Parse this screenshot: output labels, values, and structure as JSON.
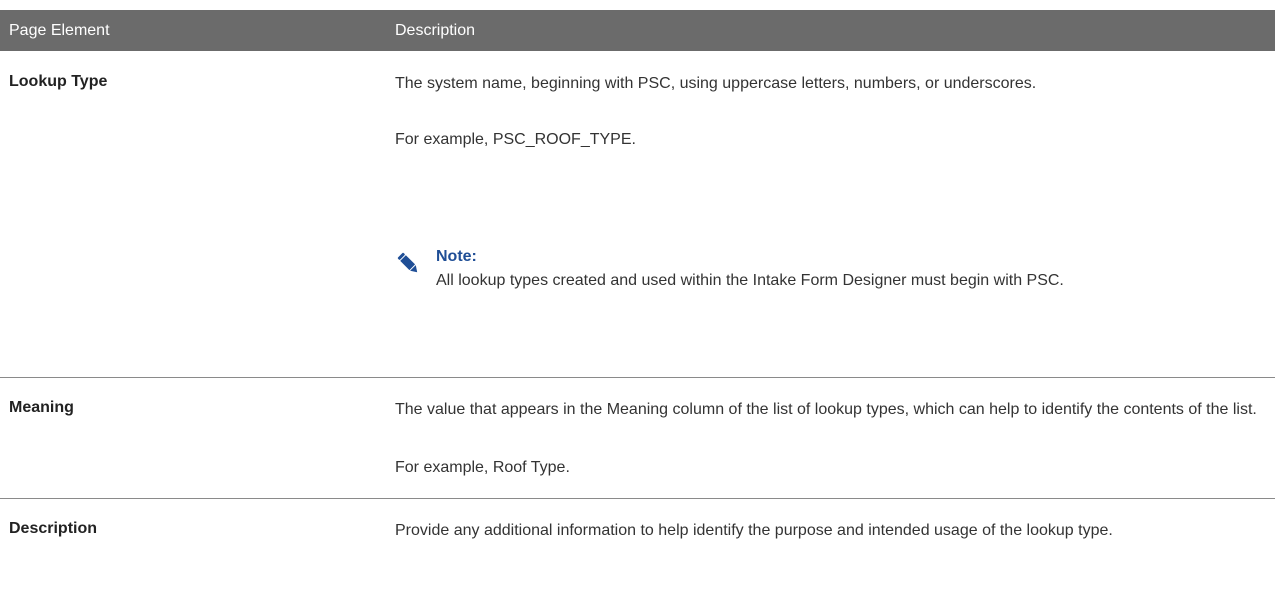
{
  "table": {
    "headers": {
      "col1": "Page Element",
      "col2": "Description"
    },
    "rows": [
      {
        "label": "Lookup Type",
        "paragraphs": [
          "The system name, beginning with PSC, using uppercase letters, numbers, or underscores.",
          "For example, PSC_ROOF_TYPE."
        ],
        "note": {
          "title": "Note:",
          "text": "All lookup types created and used within the Intake Form Designer must begin with PSC.",
          "icon": "pencil-icon",
          "color": "#1f4e96"
        }
      },
      {
        "label": "Meaning",
        "paragraphs": [
          "The value that appears in the Meaning column of the list of lookup types, which can help to identify the contents of the list.",
          "For example, Roof Type."
        ]
      },
      {
        "label": "Description",
        "paragraphs": [
          "Provide any additional information to help identify the purpose and intended usage of the lookup type."
        ]
      }
    ]
  },
  "colors": {
    "header_bg": "#6b6b6b",
    "header_text": "#ffffff",
    "divider": "#8a8a8a",
    "note_title": "#1f4e96"
  }
}
